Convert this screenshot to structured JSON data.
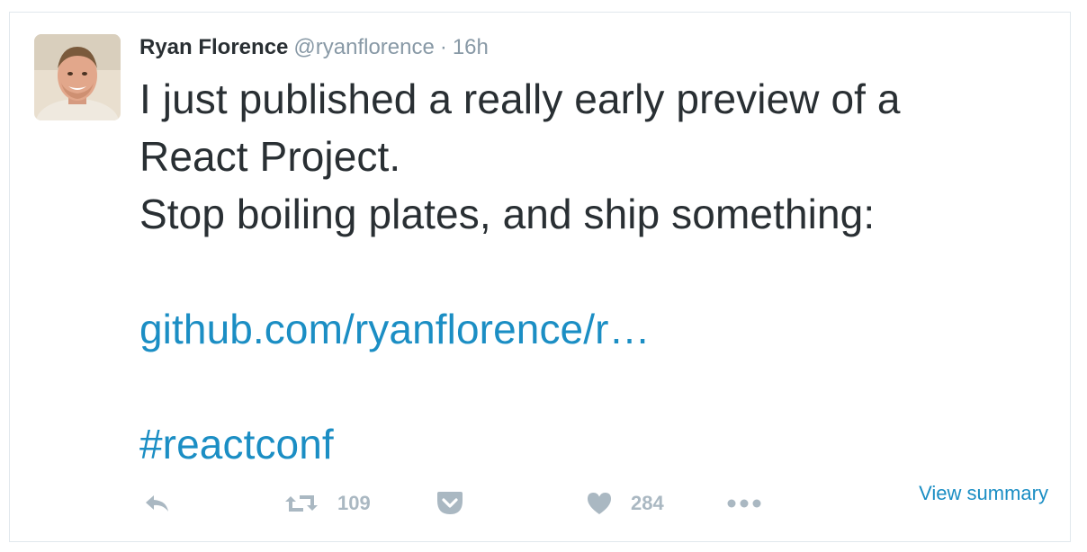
{
  "tweet": {
    "fullname": "Ryan Florence",
    "username": "@ryanflorence",
    "separator": "·",
    "time": "16h",
    "lines": [
      "I just published a really early preview of a",
      "React Project.",
      "Stop boiling plates, and ship something:"
    ],
    "link": "github.com/ryanflorence/r…",
    "hashtag": "#reactconf"
  },
  "actions": {
    "reply_icon": "reply-icon",
    "retweet_icon": "retweet-icon",
    "retweet_count": "109",
    "pocket_icon": "pocket-icon",
    "like_icon": "heart-icon",
    "like_count": "284",
    "more_icon": "more-icon",
    "view_summary": "View summary"
  },
  "colors": {
    "text": "#292f33",
    "muted": "#8899a6",
    "link": "#1b8ec4",
    "action": "#aab8c2"
  }
}
